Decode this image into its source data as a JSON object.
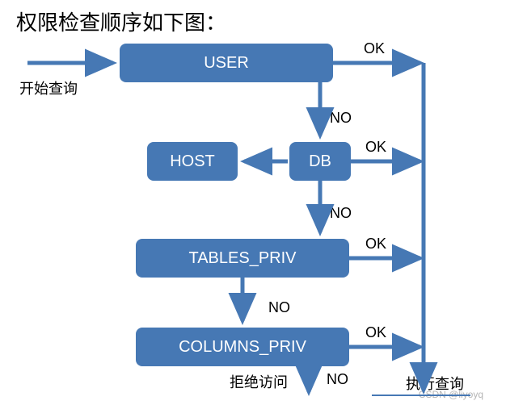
{
  "title": "权限检查顺序如下图：",
  "labels": {
    "start": "开始查询",
    "ok": "OK",
    "no": "NO",
    "deny": "拒绝访问",
    "exec": "执行查询"
  },
  "nodes": {
    "user": "USER",
    "db": "DB",
    "host": "HOST",
    "tables": "TABLES_PRIV",
    "columns": "COLUMNS_PRIV"
  },
  "colors": {
    "node_fill": "#4678b4",
    "arrow": "#4678b4"
  },
  "watermark": "CSDN @liyoyq",
  "chart_data": {
    "type": "flowchart",
    "title": "权限检查顺序",
    "nodes": [
      {
        "id": "start",
        "label": "开始查询",
        "type": "start"
      },
      {
        "id": "user",
        "label": "USER",
        "type": "decision"
      },
      {
        "id": "db",
        "label": "DB",
        "type": "decision"
      },
      {
        "id": "host",
        "label": "HOST",
        "type": "process"
      },
      {
        "id": "tables",
        "label": "TABLES_PRIV",
        "type": "decision"
      },
      {
        "id": "columns",
        "label": "COLUMNS_PRIV",
        "type": "decision"
      },
      {
        "id": "exec",
        "label": "执行查询",
        "type": "end"
      },
      {
        "id": "deny",
        "label": "拒绝访问",
        "type": "end"
      }
    ],
    "edges": [
      {
        "from": "start",
        "to": "user",
        "label": ""
      },
      {
        "from": "user",
        "to": "exec",
        "label": "OK"
      },
      {
        "from": "user",
        "to": "db",
        "label": "NO"
      },
      {
        "from": "db",
        "to": "exec",
        "label": "OK"
      },
      {
        "from": "db",
        "to": "host",
        "label": ""
      },
      {
        "from": "db",
        "to": "tables",
        "label": "NO"
      },
      {
        "from": "tables",
        "to": "exec",
        "label": "OK"
      },
      {
        "from": "tables",
        "to": "columns",
        "label": "NO"
      },
      {
        "from": "columns",
        "to": "exec",
        "label": "OK"
      },
      {
        "from": "columns",
        "to": "deny",
        "label": "NO"
      }
    ]
  }
}
